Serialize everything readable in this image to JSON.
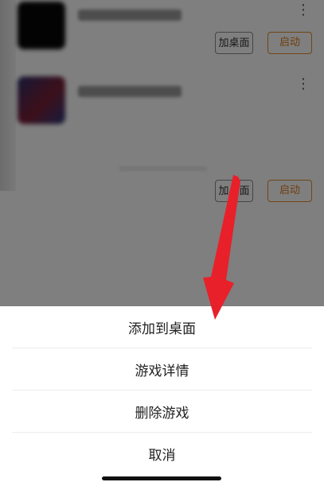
{
  "games": [
    {
      "add_to_desktop_label": "加桌面",
      "launch_label": "启动",
      "more_icon": "more-vertical-icon"
    },
    {
      "add_to_desktop_label": "加桌面",
      "launch_label": "启动",
      "more_icon": "more-vertical-icon"
    }
  ],
  "action_sheet": {
    "items": [
      {
        "label": "添加到桌面"
      },
      {
        "label": "游戏详情"
      },
      {
        "label": "删除游戏"
      },
      {
        "label": "取消"
      }
    ]
  },
  "colors": {
    "launch_accent": "#e07a1a",
    "annotation_arrow": "#e8202a"
  }
}
